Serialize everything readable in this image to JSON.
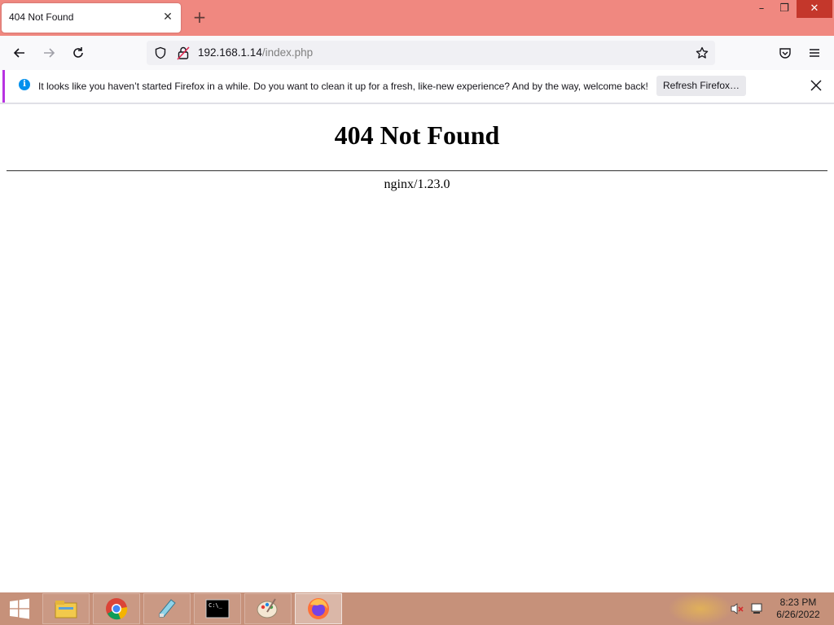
{
  "browser": {
    "tab": {
      "title": "404 Not Found",
      "close_symbol": "✕",
      "new_tab_symbol": "+"
    },
    "window_controls": {
      "minimize": "–",
      "restore": "❐",
      "close": "✕"
    },
    "url": {
      "host": "192.168.1.14",
      "path": "/index.php"
    },
    "notification": {
      "message": "It looks like you haven’t started Firefox in a while. Do you want to clean it up for a fresh, like-new experience? And by the way, welcome back!",
      "button_label": "Refresh Firefox…",
      "info_symbol": "i"
    },
    "colors": {
      "titlebar": "#f08880",
      "accent": "#b833e1"
    }
  },
  "page": {
    "heading": "404 Not Found",
    "server": "nginx/1.23.0"
  },
  "taskbar": {
    "items": [
      "file-explorer-icon",
      "chrome-icon",
      "notepad-icon",
      "cmd-icon",
      "paint-icon",
      "firefox-icon"
    ],
    "time": "8:23 PM",
    "date": "6/26/2022"
  }
}
